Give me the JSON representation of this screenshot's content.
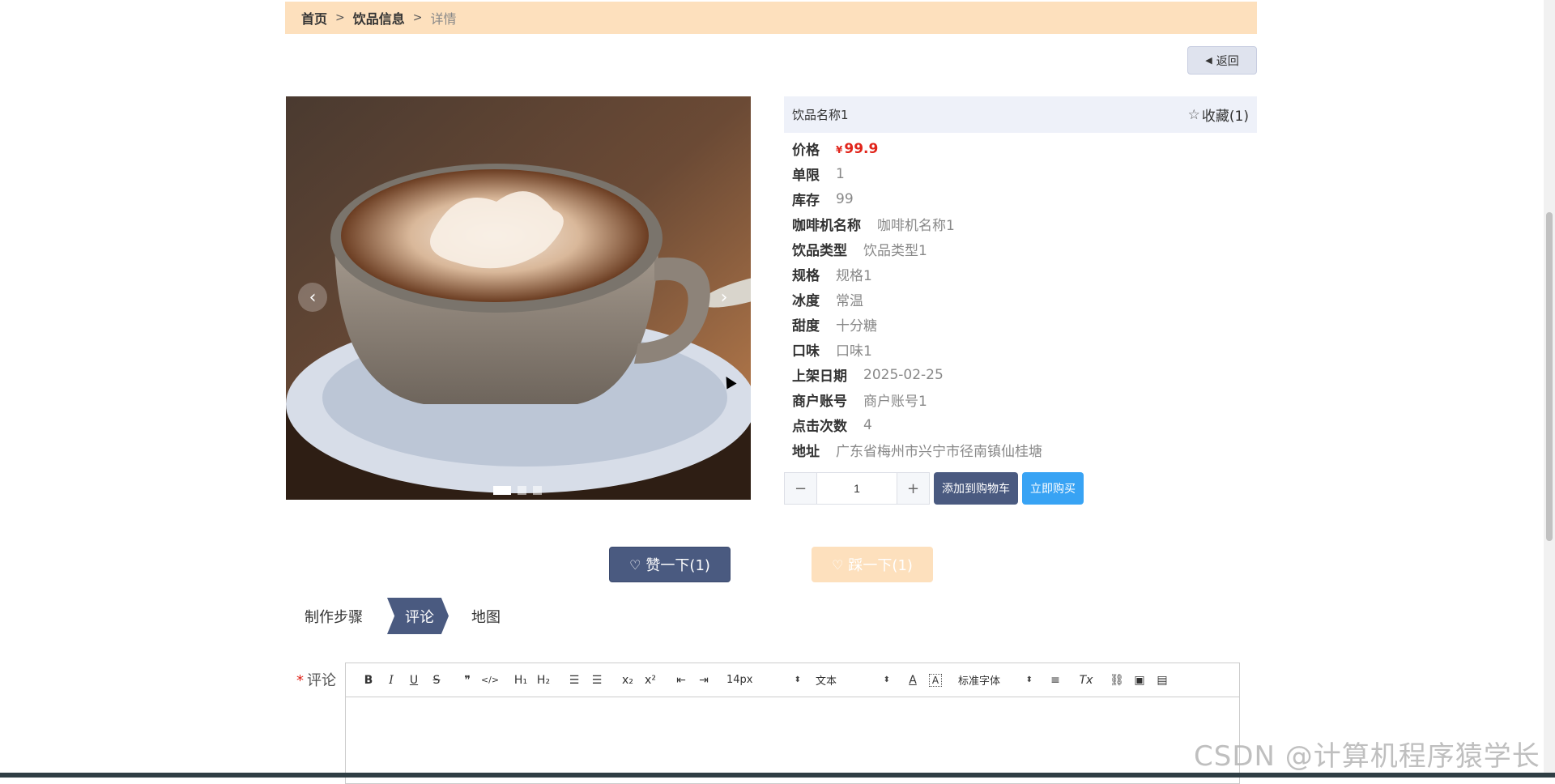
{
  "breadcrumb": {
    "home": "首页",
    "sep1": ">",
    "list": "饮品信息",
    "sep2": ">",
    "current": "详情"
  },
  "back_label": "返回",
  "product": {
    "name": "饮品名称1",
    "favorite_label": "收藏(1)",
    "price_label": "价格",
    "currency": "¥",
    "price": "99.9",
    "attributes": [
      {
        "label": "单限",
        "value": "1"
      },
      {
        "label": "库存",
        "value": "99"
      },
      {
        "label": "咖啡机名称",
        "value": "咖啡机名称1"
      },
      {
        "label": "饮品类型",
        "value": "饮品类型1"
      },
      {
        "label": "规格",
        "value": "规格1"
      },
      {
        "label": "冰度",
        "value": "常温"
      },
      {
        "label": "甜度",
        "value": "十分糖"
      },
      {
        "label": "口味",
        "value": "口味1"
      },
      {
        "label": "上架日期",
        "value": "2025-02-25"
      },
      {
        "label": "商户账号",
        "value": "商户账号1"
      },
      {
        "label": "点击次数",
        "value": "4"
      },
      {
        "label": "地址",
        "value": "广东省梅州市兴宁市径南镇仙桂塘"
      }
    ]
  },
  "quantity": {
    "minus": "−",
    "value": "1",
    "plus": "+"
  },
  "add_to_cart_label": "添加到购物车",
  "buy_now_label": "立即购买",
  "like_label": "赞一下(1)",
  "dislike_label": "踩一下(1)",
  "tabs": [
    "制作步骤",
    "评论",
    "地图"
  ],
  "comment_label": "评论",
  "required_mark": "*",
  "toolbar": {
    "bold": "B",
    "italic": "I",
    "underline": "U",
    "strike": "S",
    "blockquote": "❞",
    "code": "</>",
    "h1": "H₁",
    "h2": "H₂",
    "sub": "x₂",
    "sup": "x²",
    "size": "14px",
    "format": "文本",
    "font": "标准字体",
    "font_color": "A",
    "bg_color": "A",
    "clean": "Tx"
  },
  "watermark": "CSDN @计算机程序猿学长",
  "colors": {
    "accent": "#4a5a80",
    "breadcrumb_bg": "#fde0bd",
    "price": "#e1251b",
    "buy": "#38a3f4"
  }
}
